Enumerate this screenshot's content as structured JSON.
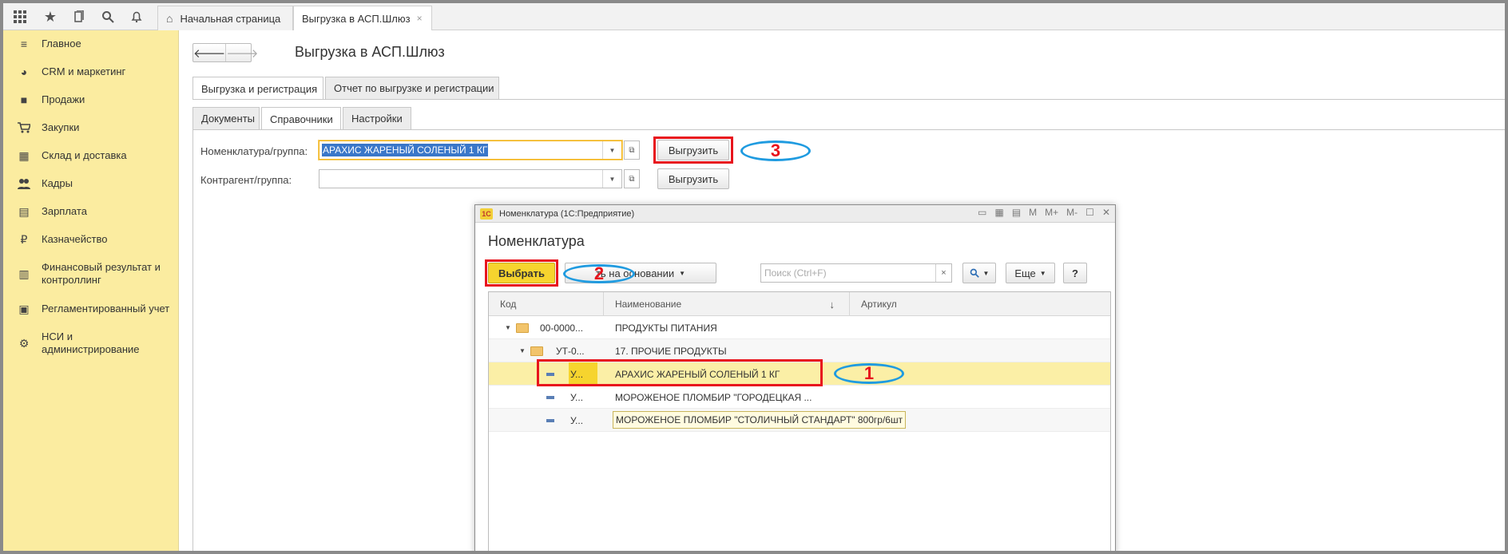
{
  "topbar": {
    "icons": [
      "apps-grid-icon",
      "star-icon",
      "history-icon",
      "search-icon",
      "bell-icon"
    ],
    "tabs": [
      {
        "label": "Начальная страница",
        "icon": "home-icon"
      },
      {
        "label": "Выгрузка в АСП.Шлюз",
        "close": "×"
      }
    ]
  },
  "sidebar": {
    "items": [
      {
        "label": "Главное",
        "icon": "menu-lines-icon",
        "glyph": "≡"
      },
      {
        "label": "CRM и маркетинг",
        "icon": "pie-chart-icon",
        "glyph": "◕"
      },
      {
        "label": "Продажи",
        "icon": "bag-icon",
        "glyph": "■"
      },
      {
        "label": "Закупки",
        "icon": "cart-icon",
        "glyph": "🛒"
      },
      {
        "label": "Склад и доставка",
        "icon": "warehouse-icon",
        "glyph": "▦"
      },
      {
        "label": "Кадры",
        "icon": "people-icon",
        "glyph": "👥"
      },
      {
        "label": "Зарплата",
        "icon": "calculator-icon",
        "glyph": "▤"
      },
      {
        "label": "Казначейство",
        "icon": "ruble-coin-icon",
        "glyph": "₽"
      },
      {
        "label": "Финансовый результат и\nконтроллинг",
        "icon": "bar-chart-icon",
        "glyph": "▥"
      },
      {
        "label": "Регламентированный учет",
        "icon": "ledger-icon",
        "glyph": "▣"
      },
      {
        "label": "НСИ и\nадминистрирование",
        "icon": "gear-icon",
        "glyph": "⚙"
      }
    ]
  },
  "main": {
    "back": "🡐",
    "forward": "🡒",
    "title": "Выгрузка в АСП.Шлюз",
    "tabs": [
      "Выгрузка и регистрация",
      "Отчет по выгрузке и регистрации"
    ],
    "subtabs": [
      "Документы",
      "Справочники",
      "Настройки"
    ],
    "form": {
      "nomenclature_label": "Номенклатура/группа:",
      "nomenclature_value": "АРАХИС ЖАРЕНЫЙ СОЛЕНЫЙ 1 КГ",
      "counterparty_label": "Контрагент/группа:",
      "counterparty_value": "",
      "export_button": "Выгрузить",
      "export_button2": "Выгрузить"
    },
    "annotations": {
      "n1": "1",
      "n2": "2",
      "n3": "3"
    }
  },
  "modal": {
    "window_title": "Номенклатура (1С:Предприятие)",
    "logo": "1С",
    "heading": "Номенклатура",
    "select_button": "Выбрать",
    "create_based_button": "ть на основании",
    "search_placeholder": "Поиск (Ctrl+F)",
    "search_clear": "×",
    "more_button": "Еще",
    "help_button": "?",
    "columns": [
      "Код",
      "Наименование",
      "Артикул"
    ],
    "sort_arrow": "↓",
    "rows": [
      {
        "code": "00-0000...",
        "name": "ПРОДУКТЫ ПИТАНИЯ",
        "type": "folder",
        "level": 0
      },
      {
        "code": "УТ-0...",
        "name": "17. ПРОЧИЕ ПРОДУКТЫ",
        "type": "folder",
        "level": 1
      },
      {
        "code": "У...",
        "name": "АРАХИС ЖАРЕНЫЙ СОЛЕНЫЙ 1 КГ",
        "type": "item",
        "level": 2,
        "selected": true
      },
      {
        "code": "У...",
        "name": "МОРОЖЕНОЕ ПЛОМБИР \"ГОРОДЕЦКАЯ ...",
        "type": "item",
        "level": 2
      },
      {
        "code": "У...",
        "name": "",
        "type": "item",
        "level": 2
      }
    ],
    "tooltip": "МОРОЖЕНОЕ ПЛОМБИР \"СТОЛИЧНЫЙ СТАНДАРТ\" 800гр/6шт"
  },
  "colors": {
    "sidebar_bg": "#fbeca0",
    "highlight_red": "#e8141d",
    "annotation_blue": "#1f9be0",
    "select_button_yellow": "#f6d42e",
    "selected_row": "#fbefa6"
  }
}
